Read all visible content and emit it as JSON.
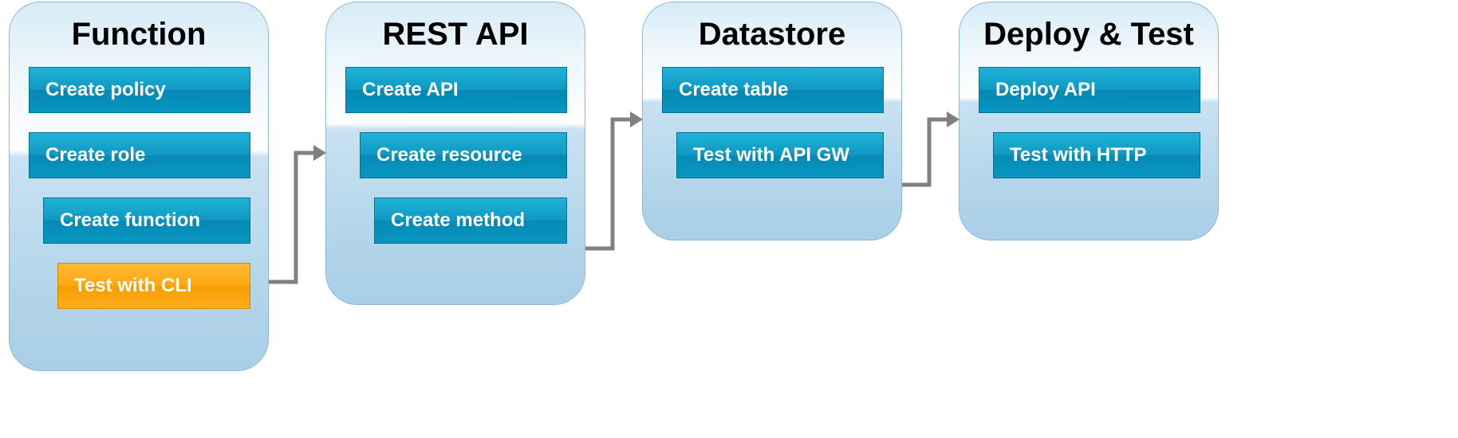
{
  "colors": {
    "step_blue": "#0b96c0",
    "step_orange": "#f9a400",
    "card_border": "#8bb9d9",
    "connector": "#808080"
  },
  "cards": [
    {
      "title": "Function",
      "steps": [
        {
          "label": "Create policy",
          "variant": "blue",
          "indent": 0
        },
        {
          "label": "Create role",
          "variant": "blue",
          "indent": 0
        },
        {
          "label": "Create function",
          "variant": "blue",
          "indent": 1
        },
        {
          "label": "Test with CLI",
          "variant": "orange",
          "indent": 2
        }
      ]
    },
    {
      "title": "REST API",
      "steps": [
        {
          "label": "Create API",
          "variant": "blue",
          "indent": 0
        },
        {
          "label": "Create resource",
          "variant": "blue",
          "indent": 1
        },
        {
          "label": "Create method",
          "variant": "blue",
          "indent": 2
        }
      ]
    },
    {
      "title": "Datastore",
      "steps": [
        {
          "label": "Create table",
          "variant": "blue",
          "indent": 0
        },
        {
          "label": "Test with API GW",
          "variant": "blue",
          "indent": 1
        }
      ]
    },
    {
      "title": "Deploy & Test",
      "steps": [
        {
          "label": "Deploy API",
          "variant": "blue",
          "indent": 0
        },
        {
          "label": "Test with HTTP",
          "variant": "blue",
          "indent": 1
        }
      ]
    }
  ]
}
